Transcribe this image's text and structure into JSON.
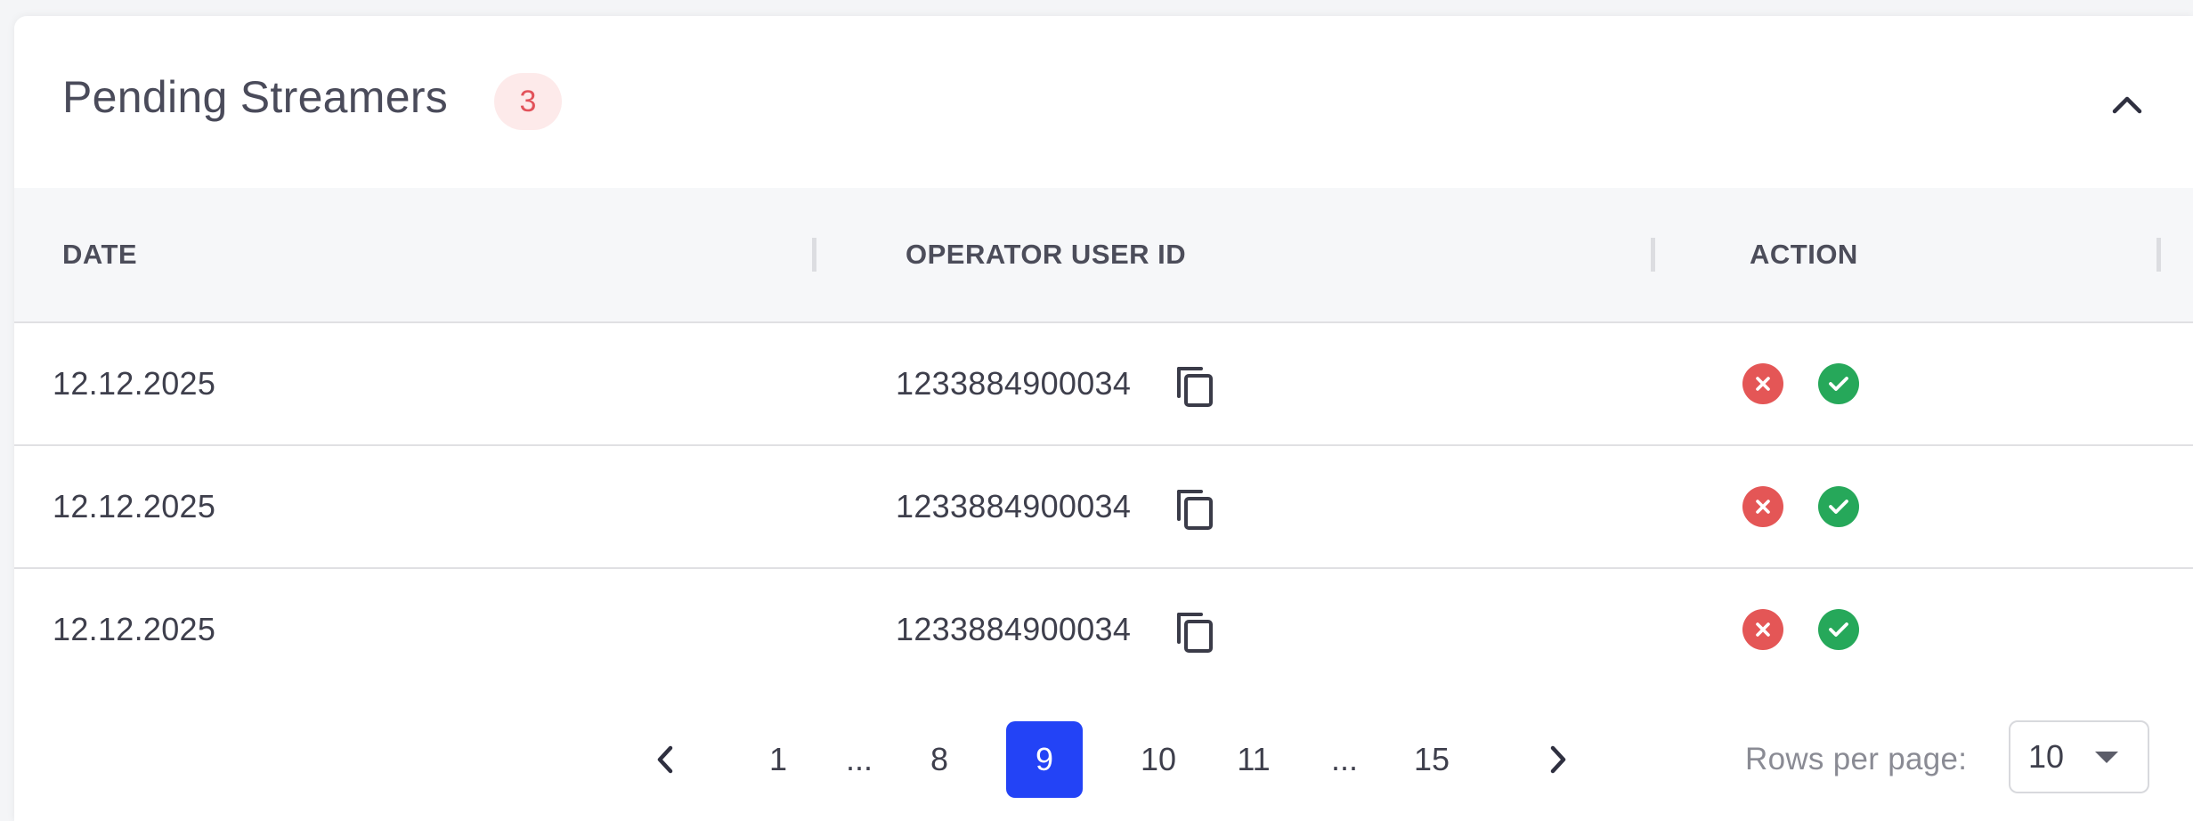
{
  "panel": {
    "title": "Pending Streamers",
    "count": "3"
  },
  "table": {
    "columns": [
      "DATE",
      "OPERATOR USER ID",
      "ACTION"
    ],
    "rows": [
      {
        "date": "12.12.2025",
        "operator_user_id": "1233884900034"
      },
      {
        "date": "12.12.2025",
        "operator_user_id": "1233884900034"
      },
      {
        "date": "12.12.2025",
        "operator_user_id": "1233884900034"
      }
    ]
  },
  "pagination": {
    "pages": [
      "1",
      "...",
      "8",
      "9",
      "10",
      "11",
      "...",
      "15"
    ],
    "current_page": "9",
    "rows_per_page_label": "Rows per page:",
    "rows_per_page_value": "10"
  },
  "icons": {
    "collapse": "chevron-up-icon",
    "copy": "copy-icon",
    "reject": "close-circle-icon",
    "approve": "check-circle-icon",
    "prev": "chevron-left-icon",
    "next": "chevron-right-icon",
    "dropdown": "caret-down-icon"
  },
  "colors": {
    "accent": "#2343f6",
    "badge_bg": "#fdeaea",
    "badge_text": "#e2525a",
    "reject": "#e45656",
    "approve": "#26a85a"
  }
}
